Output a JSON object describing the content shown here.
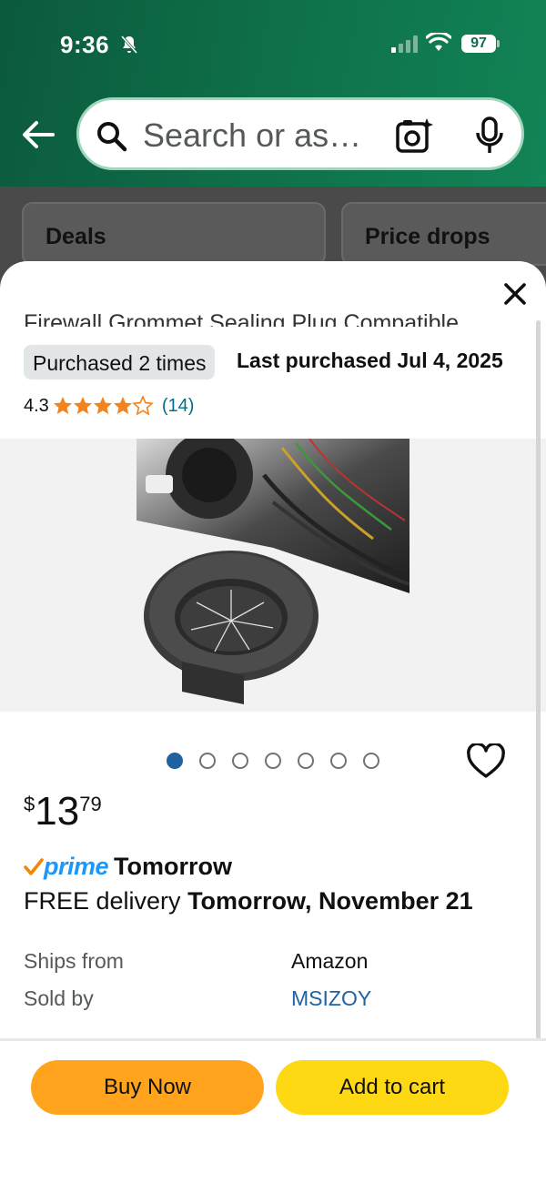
{
  "status_bar": {
    "time": "9:36",
    "battery": "97"
  },
  "search": {
    "placeholder": "Search or as…"
  },
  "chips": {
    "deals": "Deals",
    "price_drops": "Price drops"
  },
  "product": {
    "title": "Firewall Grommet Sealing Plug Compatible…",
    "purchased_badge": "Purchased 2 times",
    "last_purchased": "Last purchased Jul 4, 2025",
    "rating": "4.3",
    "rating_value": 4.3,
    "rating_count": "(14)",
    "image_count": 7,
    "active_image": 1,
    "price": {
      "symbol": "$",
      "whole": "13",
      "fraction": "79"
    },
    "prime": {
      "logo_text": "prime",
      "when": "Tomorrow"
    },
    "delivery": {
      "prefix": "FREE delivery",
      "date": "Tomorrow, November 21"
    },
    "ships_from": {
      "label": "Ships from",
      "value": "Amazon"
    },
    "sold_by": {
      "label": "Sold by",
      "value": "MSIZOY"
    }
  },
  "actions": {
    "buy_now": "Buy Now",
    "add_to_cart": "Add to cart"
  },
  "colors": {
    "header_green": "#0e6e48",
    "buy_now": "#ffa41c",
    "add_to_cart": "#ffd814",
    "star": "#f3831e",
    "link": "#2162a1",
    "prime_blue": "#1a98ff"
  },
  "icons": {
    "back": "back-arrow-icon",
    "search": "search-icon",
    "camera": "camera-lens-icon",
    "mic": "microphone-icon",
    "close": "close-icon",
    "heart": "heart-icon",
    "bell": "bell-off-icon"
  }
}
